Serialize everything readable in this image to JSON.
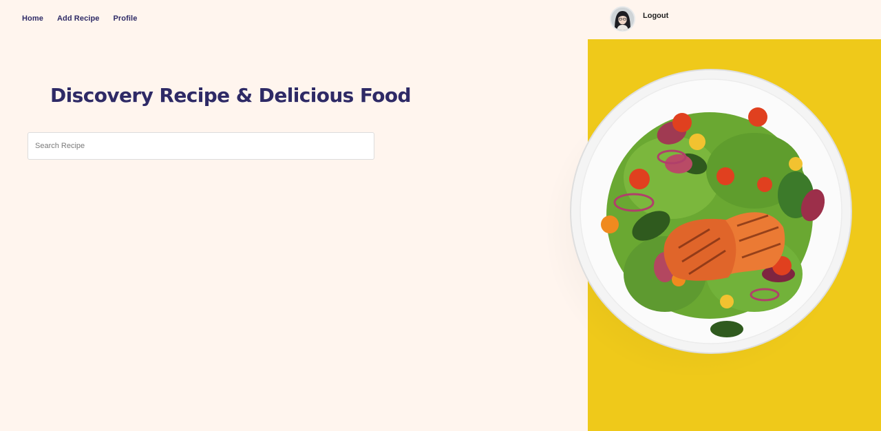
{
  "nav": {
    "links": [
      {
        "label": "Home"
      },
      {
        "label": "Add Recipe"
      },
      {
        "label": "Profile"
      }
    ],
    "logout_label": "Logout"
  },
  "hero": {
    "title": "Discovery Recipe & Delicious Food",
    "search_placeholder": "Search Recipe"
  },
  "colors": {
    "background": "#fff5ee",
    "accent_yellow": "#efc91a",
    "heading": "#2e2a66"
  },
  "images": {
    "avatar": "user-profile-photo",
    "hero": "salmon-salad-plate"
  }
}
